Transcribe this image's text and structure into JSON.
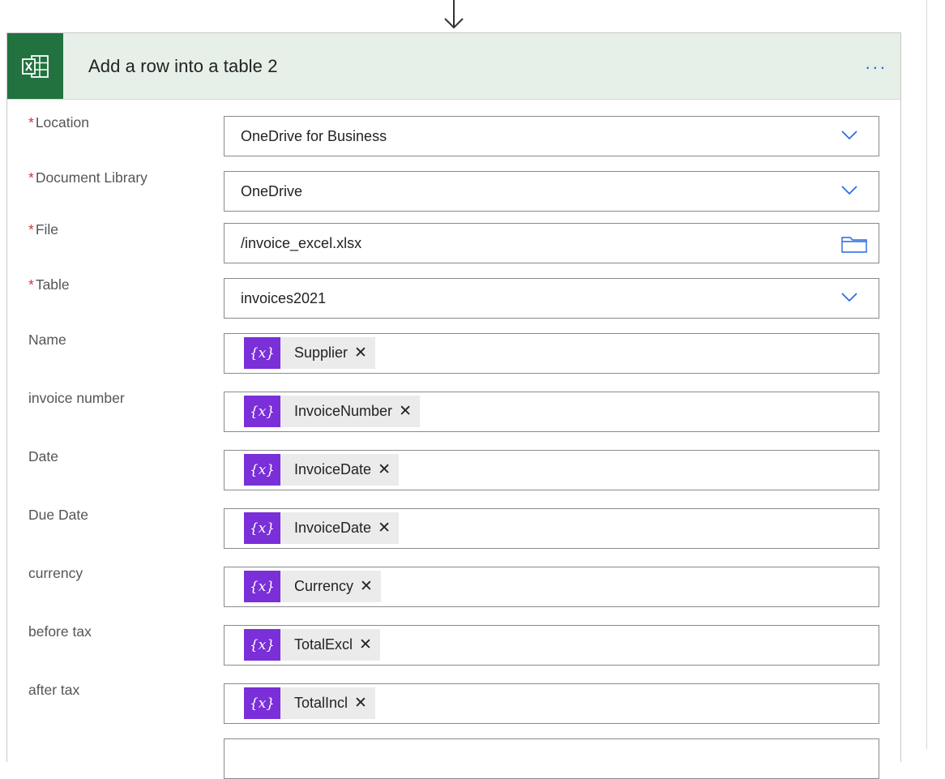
{
  "action": {
    "title": "Add a row into a table 2",
    "more_label": "...",
    "connector_icon": "excel-icon"
  },
  "fields": [
    {
      "key": "location",
      "label": "Location",
      "required": true,
      "type": "dropdown",
      "value": "OneDrive for Business"
    },
    {
      "key": "document-library",
      "label": "Document Library",
      "required": true,
      "type": "dropdown",
      "value": "OneDrive"
    },
    {
      "key": "file",
      "label": "File",
      "required": true,
      "type": "file",
      "value": "/invoice_excel.xlsx"
    },
    {
      "key": "table",
      "label": "Table",
      "required": true,
      "type": "dropdown",
      "value": "invoices2021"
    },
    {
      "key": "name",
      "label": "Name",
      "required": false,
      "type": "token",
      "token": "Supplier"
    },
    {
      "key": "invoice-number",
      "label": "invoice number",
      "required": false,
      "type": "token",
      "token": "InvoiceNumber"
    },
    {
      "key": "date",
      "label": "Date",
      "required": false,
      "type": "token",
      "token": "InvoiceDate"
    },
    {
      "key": "due-date",
      "label": "Due Date",
      "required": false,
      "type": "token",
      "token": "InvoiceDate"
    },
    {
      "key": "currency",
      "label": "currency",
      "required": false,
      "type": "token",
      "token": "Currency"
    },
    {
      "key": "before-tax",
      "label": "before tax",
      "required": false,
      "type": "token",
      "token": "TotalExcl"
    },
    {
      "key": "after-tax",
      "label": "after tax",
      "required": false,
      "type": "token",
      "token": "TotalIncl"
    }
  ],
  "labels": {
    "required_mark": "*",
    "token_icon": "{x}",
    "token_close": "✕"
  },
  "colors": {
    "header_bg": "#e6efe8",
    "excel_green": "#21723f",
    "token_purple": "#7a2fd8",
    "chevron_blue": "#2266e3",
    "required_red": "#d13438"
  }
}
